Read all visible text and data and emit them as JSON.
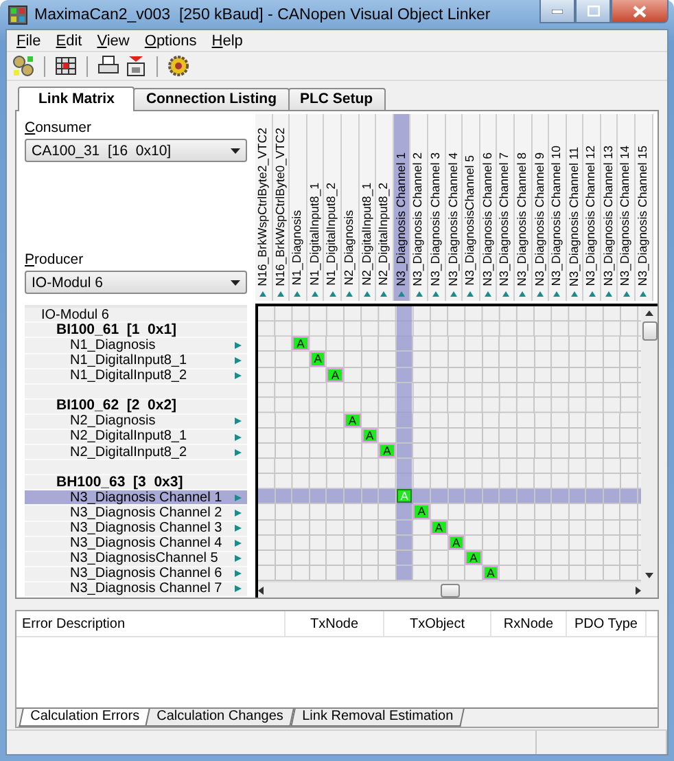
{
  "window": {
    "title": "MaximaCan2_v003  [250 kBaud] - CANopen Visual Object Linker"
  },
  "menu": [
    "File",
    "Edit",
    "View",
    "Options",
    "Help"
  ],
  "tabs": [
    {
      "label": "Link Matrix",
      "selected": true
    },
    {
      "label": "Connection Listing",
      "selected": false
    },
    {
      "label": "PLC Setup",
      "selected": false
    }
  ],
  "consumer": {
    "label": "Consumer",
    "value": "CA100_31  [16  0x10]"
  },
  "producer": {
    "label": "Producer",
    "value": "IO-Modul 6"
  },
  "columns": [
    {
      "label": "N16_BrkWspCtrlByte2_VTC2",
      "selected": false
    },
    {
      "label": "N16_BrkWspCtrlByte0_VTC2",
      "selected": false
    },
    {
      "label": "N1_Diagnosis",
      "selected": false
    },
    {
      "label": "N1_DigitalInput8_1",
      "selected": false
    },
    {
      "label": "N1_DigitalInput8_2",
      "selected": false
    },
    {
      "label": "N2_Diagnosis",
      "selected": false
    },
    {
      "label": "N2_DigitalInput8_1",
      "selected": false
    },
    {
      "label": "N2_DigitalInput8_2",
      "selected": false
    },
    {
      "label": "N3_Diagnosis Channel 1",
      "selected": true
    },
    {
      "label": "N3_Diagnosis Channel 2",
      "selected": false
    },
    {
      "label": "N3_Diagnosis Channel 3",
      "selected": false
    },
    {
      "label": "N3_Diagnosis Channel 4",
      "selected": false
    },
    {
      "label": "N3_DiagnosisChannel 5",
      "selected": false
    },
    {
      "label": "N3_Diagnosis Channel 6",
      "selected": false
    },
    {
      "label": "N3_Diagnosis Channel 7",
      "selected": false
    },
    {
      "label": "N3_Diagnosis Channel 8",
      "selected": false
    },
    {
      "label": "N3_Diagnosis Channel 9",
      "selected": false
    },
    {
      "label": "N3_Diagnosis Channel 10",
      "selected": false
    },
    {
      "label": "N3_Diagnosis Channel 11",
      "selected": false
    },
    {
      "label": "N3_Diagnosis Channel 12",
      "selected": false
    },
    {
      "label": "N3_Diagnosis Channel 13",
      "selected": false
    },
    {
      "label": "N3_Diagnosis Channel 14",
      "selected": false
    },
    {
      "label": "N3_Diagnosis Channel 15",
      "selected": false
    }
  ],
  "rows": [
    {
      "kind": "root",
      "label": "IO-Modul 6"
    },
    {
      "kind": "group",
      "label": "BI100_61  [1  0x1]"
    },
    {
      "kind": "item",
      "label": "N1_Diagnosis",
      "selected": false,
      "link_label": "A",
      "links": [
        false,
        false,
        true,
        false,
        false,
        false,
        false,
        false,
        false,
        false,
        false,
        false,
        false,
        false,
        false,
        false,
        false,
        false,
        false,
        false,
        false,
        false,
        false
      ]
    },
    {
      "kind": "item",
      "label": "N1_DigitalInput8_1",
      "selected": false,
      "link_label": "A",
      "links": [
        false,
        false,
        false,
        true,
        false,
        false,
        false,
        false,
        false,
        false,
        false,
        false,
        false,
        false,
        false,
        false,
        false,
        false,
        false,
        false,
        false,
        false,
        false
      ]
    },
    {
      "kind": "item",
      "label": "N1_DigitalInput8_2",
      "selected": false,
      "link_label": "A",
      "links": [
        false,
        false,
        false,
        false,
        true,
        false,
        false,
        false,
        false,
        false,
        false,
        false,
        false,
        false,
        false,
        false,
        false,
        false,
        false,
        false,
        false,
        false,
        false
      ]
    },
    {
      "kind": "blank"
    },
    {
      "kind": "group",
      "label": "BI100_62  [2  0x2]"
    },
    {
      "kind": "item",
      "label": "N2_Diagnosis",
      "selected": false,
      "link_label": "A",
      "links": [
        false,
        false,
        false,
        false,
        false,
        true,
        false,
        false,
        false,
        false,
        false,
        false,
        false,
        false,
        false,
        false,
        false,
        false,
        false,
        false,
        false,
        false,
        false
      ]
    },
    {
      "kind": "item",
      "label": "N2_DigitalInput8_1",
      "selected": false,
      "link_label": "A",
      "links": [
        false,
        false,
        false,
        false,
        false,
        false,
        true,
        false,
        false,
        false,
        false,
        false,
        false,
        false,
        false,
        false,
        false,
        false,
        false,
        false,
        false,
        false,
        false
      ]
    },
    {
      "kind": "item",
      "label": "N2_DigitalInput8_2",
      "selected": false,
      "link_label": "A",
      "links": [
        false,
        false,
        false,
        false,
        false,
        false,
        false,
        true,
        false,
        false,
        false,
        false,
        false,
        false,
        false,
        false,
        false,
        false,
        false,
        false,
        false,
        false,
        false
      ]
    },
    {
      "kind": "blank"
    },
    {
      "kind": "group",
      "label": "BH100_63  [3  0x3]"
    },
    {
      "kind": "item",
      "label": "N3_Diagnosis Channel 1",
      "selected": true,
      "link_label": "A",
      "links": [
        false,
        false,
        false,
        false,
        false,
        false,
        false,
        false,
        true,
        false,
        false,
        false,
        false,
        false,
        false,
        false,
        false,
        false,
        false,
        false,
        false,
        false,
        false
      ]
    },
    {
      "kind": "item",
      "label": "N3_Diagnosis Channel 2",
      "selected": false,
      "link_label": "A",
      "links": [
        false,
        false,
        false,
        false,
        false,
        false,
        false,
        false,
        false,
        true,
        false,
        false,
        false,
        false,
        false,
        false,
        false,
        false,
        false,
        false,
        false,
        false,
        false
      ]
    },
    {
      "kind": "item",
      "label": "N3_Diagnosis Channel 3",
      "selected": false,
      "link_label": "A",
      "links": [
        false,
        false,
        false,
        false,
        false,
        false,
        false,
        false,
        false,
        false,
        true,
        false,
        false,
        false,
        false,
        false,
        false,
        false,
        false,
        false,
        false,
        false,
        false
      ]
    },
    {
      "kind": "item",
      "label": "N3_Diagnosis Channel 4",
      "selected": false,
      "link_label": "A",
      "links": [
        false,
        false,
        false,
        false,
        false,
        false,
        false,
        false,
        false,
        false,
        false,
        true,
        false,
        false,
        false,
        false,
        false,
        false,
        false,
        false,
        false,
        false,
        false
      ]
    },
    {
      "kind": "item",
      "label": "N3_DiagnosisChannel 5",
      "selected": false,
      "link_label": "A",
      "links": [
        false,
        false,
        false,
        false,
        false,
        false,
        false,
        false,
        false,
        false,
        false,
        false,
        true,
        false,
        false,
        false,
        false,
        false,
        false,
        false,
        false,
        false,
        false
      ]
    },
    {
      "kind": "item",
      "label": "N3_Diagnosis Channel 6",
      "selected": false,
      "link_label": "A",
      "links": [
        false,
        false,
        false,
        false,
        false,
        false,
        false,
        false,
        false,
        false,
        false,
        false,
        false,
        true,
        false,
        false,
        false,
        false,
        false,
        false,
        false,
        false,
        false
      ]
    },
    {
      "kind": "item",
      "label": "N3_Diagnosis Channel 7",
      "selected": false
    }
  ],
  "errors_table": {
    "columns": [
      "Error Description",
      "TxNode",
      "TxObject",
      "RxNode",
      "PDO Type"
    ]
  },
  "bottom_tabs": [
    {
      "label": "Calculation Errors",
      "selected": true
    },
    {
      "label": "Calculation Changes",
      "selected": false
    },
    {
      "label": "Link Removal Estimation",
      "selected": false
    }
  ]
}
